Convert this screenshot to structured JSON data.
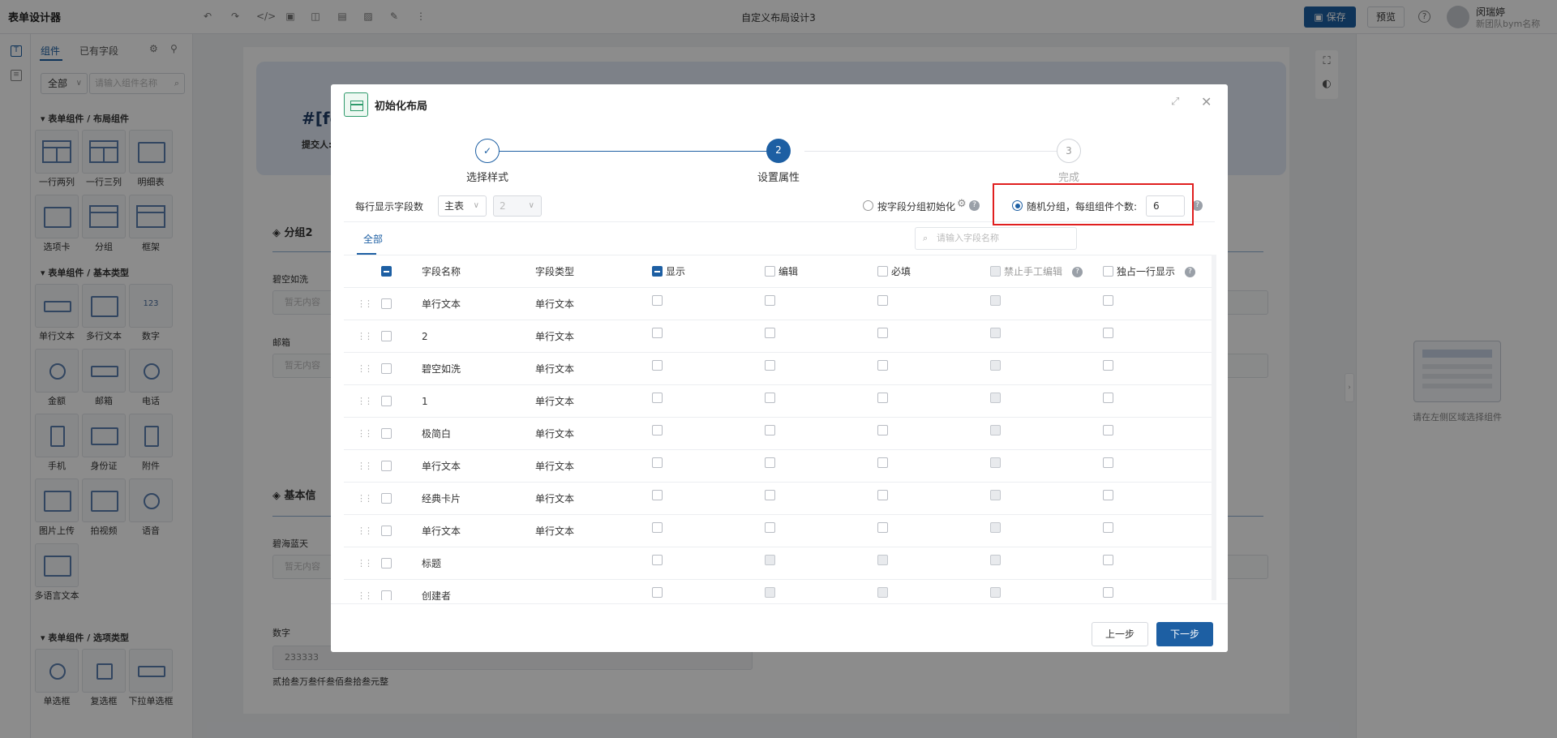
{
  "app": {
    "title": "表单设计器",
    "doc_title": "自定义布局设计3"
  },
  "toolbar": {
    "icons": [
      "undo-icon",
      "redo-icon",
      "code-icon",
      "image-icon",
      "layout-icon",
      "save-draft-icon",
      "picture-icon",
      "edit-icon",
      "more-icon"
    ],
    "save_label": "保存",
    "preview_label": "预览",
    "help_glyph": "?"
  },
  "user": {
    "name": "闵瑞婷",
    "team": "新团队bym名称"
  },
  "panel": {
    "tabs": [
      "组件",
      "已有字段"
    ],
    "filter_value": "全部",
    "search_placeholder": "请输入组件名称",
    "groups": [
      {
        "title": "表单组件 / 布局组件",
        "items": [
          "一行两列",
          "一行三列",
          "明细表",
          "选项卡",
          "分组",
          "框架"
        ]
      },
      {
        "title": "表单组件 / 基本类型",
        "items": [
          "单行文本",
          "多行文本",
          "数字",
          "金额",
          "邮箱",
          "电话",
          "手机",
          "身份证",
          "附件",
          "图片上传",
          "拍视频",
          "语音",
          "多语言文本"
        ]
      },
      {
        "title": "表单组件 / 选项类型",
        "items": [
          "单选框",
          "复选框",
          "下拉单选框"
        ]
      }
    ],
    "number_glyph": "123"
  },
  "canvas": {
    "banner_title": "#[fo",
    "banner_sub": "提交人:",
    "sections": [
      "分组2",
      "基本信"
    ],
    "fields": [
      {
        "label": "碧空如洗",
        "placeholder": "暂无内容"
      },
      {
        "label": "邮箱",
        "placeholder": "暂无内容"
      },
      {
        "label": "碧海蓝天",
        "placeholder": "暂无内容"
      }
    ],
    "number_label": "数字",
    "number_value": "233333",
    "number_upper": "贰拾叁万叁仟叁佰叁拾叁元整"
  },
  "prop_panel": {
    "empty_text": "请在左侧区域选择组件"
  },
  "modal": {
    "title": "初始化布局",
    "steps": [
      {
        "label": "选择样式",
        "state": "done",
        "mark": "✓"
      },
      {
        "label": "设置属性",
        "state": "active",
        "mark": "2"
      },
      {
        "label": "完成",
        "state": "todo",
        "mark": "3"
      }
    ],
    "config": {
      "per_row_label": "每行显示字段数",
      "table_select": "主表",
      "count_select": "2",
      "by_group_label": "按字段分组初始化",
      "random_label": "随机分组，每组组件个数:",
      "random_value": "6"
    },
    "tab_all": "全部",
    "field_search_placeholder": "请输入字段名称",
    "columns": {
      "name": "字段名称",
      "type": "字段类型",
      "show": "显示",
      "edit": "编辑",
      "required": "必填",
      "no_manual": "禁止手工编辑",
      "own_row": "独占一行显示"
    },
    "rows": [
      {
        "name": "单行文本",
        "type": "单行文本",
        "system": false
      },
      {
        "name": "2",
        "type": "单行文本",
        "system": false
      },
      {
        "name": "碧空如洗",
        "type": "单行文本",
        "system": false
      },
      {
        "name": "1",
        "type": "单行文本",
        "system": false
      },
      {
        "name": "极简白",
        "type": "单行文本",
        "system": false
      },
      {
        "name": "单行文本",
        "type": "单行文本",
        "system": false
      },
      {
        "name": "经典卡片",
        "type": "单行文本",
        "system": false
      },
      {
        "name": "单行文本",
        "type": "单行文本",
        "system": false
      },
      {
        "name": "标题",
        "type": "",
        "system": true
      },
      {
        "name": "创建者",
        "type": "",
        "system": true
      }
    ],
    "prev_label": "上一步",
    "next_label": "下一步"
  },
  "colors": {
    "primary": "#1d5fa3",
    "highlight": "#e01f1f",
    "success": "#2e9a6b"
  }
}
